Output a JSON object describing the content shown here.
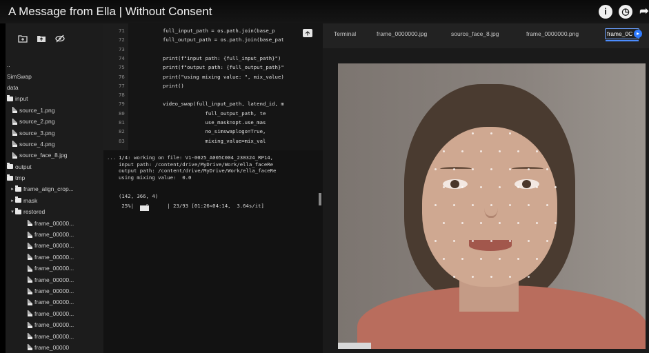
{
  "video": {
    "title": "A Message from Ella | Without Consent"
  },
  "top_icons": [
    "info-icon",
    "clock-icon",
    "share-icon"
  ],
  "file_browser": {
    "toolbar_icons": [
      "new-folder-icon",
      "upload-folder-icon",
      "hide-eye-icon"
    ],
    "items": [
      {
        "label": "..",
        "kind": "up",
        "indent": 0
      },
      {
        "label": "SimSwap",
        "kind": "text",
        "indent": 0
      },
      {
        "label": "data",
        "kind": "text",
        "indent": 0
      },
      {
        "label": "input",
        "kind": "folder",
        "indent": 0
      },
      {
        "label": "source_1.png",
        "kind": "file",
        "indent": 1
      },
      {
        "label": "source_2.png",
        "kind": "file",
        "indent": 1
      },
      {
        "label": "source_3.png",
        "kind": "file",
        "indent": 1
      },
      {
        "label": "source_4.png",
        "kind": "file",
        "indent": 1
      },
      {
        "label": "source_face_8.jpg",
        "kind": "file",
        "indent": 1
      },
      {
        "label": "output",
        "kind": "folder",
        "indent": 0
      },
      {
        "label": "tmp",
        "kind": "folder",
        "indent": 0
      },
      {
        "label": "frame_align_crop...",
        "kind": "folder-collapsed",
        "indent": 1
      },
      {
        "label": "mask",
        "kind": "folder-collapsed",
        "indent": 1
      },
      {
        "label": "restored",
        "kind": "folder-expanded",
        "indent": 1
      },
      {
        "label": "frame_00000...",
        "kind": "file",
        "indent": 2
      },
      {
        "label": "frame_00000...",
        "kind": "file",
        "indent": 2
      },
      {
        "label": "frame_00000...",
        "kind": "file",
        "indent": 2
      },
      {
        "label": "frame_00000...",
        "kind": "file",
        "indent": 2
      },
      {
        "label": "frame_00000...",
        "kind": "file",
        "indent": 2
      },
      {
        "label": "frame_00000...",
        "kind": "file",
        "indent": 2
      },
      {
        "label": "frame_00000...",
        "kind": "file",
        "indent": 2
      },
      {
        "label": "frame_00000...",
        "kind": "file",
        "indent": 2
      },
      {
        "label": "frame_00000...",
        "kind": "file",
        "indent": 2
      },
      {
        "label": "frame_00000...",
        "kind": "file",
        "indent": 2
      },
      {
        "label": "frame_00000...",
        "kind": "file",
        "indent": 2
      },
      {
        "label": "frame_00000",
        "kind": "file",
        "indent": 2
      }
    ]
  },
  "editor": {
    "lines": [
      {
        "num": "71",
        "code": "full_input_path = os.path.join(base_p"
      },
      {
        "num": "72",
        "code": "full_output_path = os.path.join(base_pat"
      },
      {
        "num": "73",
        "code": ""
      },
      {
        "num": "74",
        "code": "print(f\"input path: {full_input_path}\")"
      },
      {
        "num": "75",
        "code": "print(f\"output path: {full_output_path}\""
      },
      {
        "num": "76",
        "code": "print(\"using mixing value: \", mix_value)"
      },
      {
        "num": "77",
        "code": "print()"
      },
      {
        "num": "78",
        "code": ""
      },
      {
        "num": "79",
        "code": "video_swap(full_input_path, latend_id, m"
      },
      {
        "num": "80",
        "code": "              full_output_path, te"
      },
      {
        "num": "81",
        "code": "              use_mask=opt.use_mas"
      },
      {
        "num": "82",
        "code": "              no_simswaplogo=True,"
      },
      {
        "num": "83",
        "code": "              mixing_value=mix_val"
      }
    ]
  },
  "output": {
    "ellipsis": "...",
    "lines": [
      "1/4: working on file: V1-0025_A005C004_230324_RP14,",
      "input path: /content/drive/MyDrive/Work/ella_faceRe",
      "output path: /content/drive/MyDrive/Work/ella_faceRe",
      "using mixing value:  0.0",
      "",
      "(142, 366, 4)",
      " 25%|    &      | 23/93 [01:26<04:14,  3.64s/it]"
    ],
    "progress_fraction": 0.25
  },
  "tabs": [
    {
      "label": "Terminal",
      "active": false
    },
    {
      "label": "frame_0000000.jpg",
      "active": false
    },
    {
      "label": "source_face_8.jpg",
      "active": false
    },
    {
      "label": "frame_0000000.png",
      "active": false
    },
    {
      "label": "frame_0C",
      "active": true
    }
  ],
  "colors": {
    "accent": "#4c8dff",
    "panel_bg": "#1c1c1c",
    "shirt": "#b96d5d"
  }
}
